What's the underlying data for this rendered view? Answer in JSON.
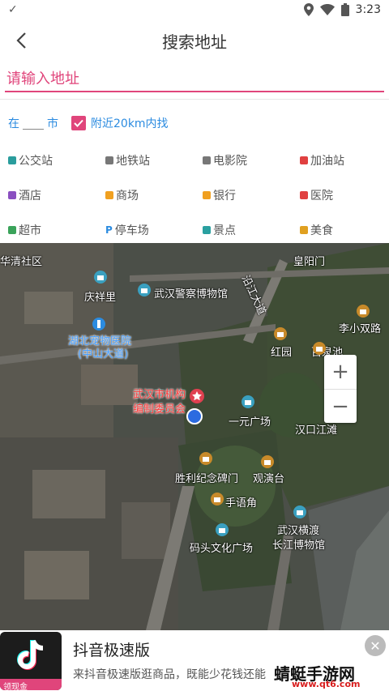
{
  "status": {
    "time": "3:23"
  },
  "appbar": {
    "title": "搜索地址"
  },
  "search": {
    "placeholder": "请输入地址",
    "value": ""
  },
  "city": {
    "prefix": "在",
    "suffix": "市",
    "value": "",
    "nearby_checked": true,
    "nearby_label": "附近20km内找"
  },
  "categories": [
    [
      "公交站",
      "地铁站",
      "电影院",
      "加油站"
    ],
    [
      "酒店",
      "商场",
      "银行",
      "医院"
    ],
    [
      "超市",
      "停车场",
      "景点",
      "美食"
    ]
  ],
  "category_colors": [
    "#2a9d9d",
    "#777",
    "#777",
    "#e04040",
    "#8a4fc0",
    "#f0a020",
    "#f0a020",
    "#e04040",
    "#3aa35a",
    "#2b8be0",
    "#2aa0a0",
    "#e0a020"
  ],
  "map": {
    "labels": {
      "huaqing": "华清社区",
      "qingxiang": "庆祥里",
      "police_museum": "武汉警察博物馆",
      "children_hospital": "湖北宠物医院",
      "children_hospital_sub": "(中山大道)",
      "yanjiang": "沿江大道",
      "huangmen": "皇阳门",
      "lixiao": "李小双路",
      "hongyuan": "红园",
      "baiquan": "百泉池",
      "jiguan_1": "武汉市机构",
      "jiguan_2": "编制委员会",
      "yiyuan": "一元广场",
      "jiangtan": "汉口江滩",
      "shenglijinian": "胜利纪念碑门",
      "guanyan": "观演台",
      "shouyu": "手语角",
      "hengdu_1": "武汉横渡",
      "hengdu_2": "长江博物馆",
      "matou": "码头文化广场"
    },
    "zoom_in": "+",
    "zoom_out": "−"
  },
  "ad": {
    "title": "抖音极速版",
    "desc": "来抖音极速版逛商品，既能少花钱还能",
    "badge": "领现金",
    "watermark": "蜻蜓手游网",
    "watermark_sub": "www.qt6.com"
  }
}
